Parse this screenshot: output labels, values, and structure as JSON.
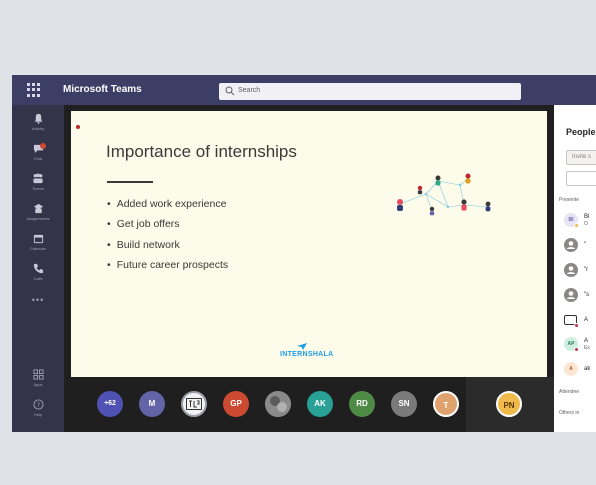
{
  "app": {
    "title": "Microsoft Teams",
    "search_placeholder": "Search"
  },
  "rail": {
    "items": [
      {
        "label": "Activity",
        "icon": "bell-icon"
      },
      {
        "label": "Chat",
        "icon": "chat-icon"
      },
      {
        "label": "Teams",
        "icon": "teams-icon"
      },
      {
        "label": "Assignments",
        "icon": "assignments-icon"
      },
      {
        "label": "Calendar",
        "icon": "calendar-icon"
      },
      {
        "label": "Calls",
        "icon": "phone-icon"
      },
      {
        "label": "Apps",
        "icon": "apps-icon"
      },
      {
        "label": "Help",
        "icon": "help-icon"
      }
    ],
    "more": "•••"
  },
  "slide": {
    "title": "Importance of internships",
    "bullets": [
      "Added work experience",
      "Get job offers",
      "Build network",
      "Future career prospects"
    ],
    "brand": "INTERNSHALA"
  },
  "participants": [
    {
      "initials": "+62",
      "color": "#4f52b2"
    },
    {
      "initials": "M",
      "color": "#6264a7"
    },
    {
      "initials": "",
      "color": "#f4f4f4"
    },
    {
      "initials": "GP",
      "color": "#cc4a31"
    },
    {
      "initials": "",
      "color": "#6d6d6d"
    },
    {
      "initials": "AK",
      "color": "#2aa197"
    },
    {
      "initials": "RD",
      "color": "#4e8b47"
    },
    {
      "initials": "SN",
      "color": "#7a7a7a"
    },
    {
      "initials": "T",
      "color": "#e0a26c"
    }
  ],
  "self": {
    "initials": "PN",
    "color": "#f0b94c"
  },
  "people_panel": {
    "title": "People",
    "invite_placeholder": "Invite s",
    "sections": {
      "presenters": "Presente",
      "attendees": "Attendee",
      "others": "Others in"
    },
    "rows": [
      {
        "initials": "BI",
        "name": "Bl",
        "subtitle": "O"
      },
      {
        "initials": "",
        "name": "\""
      },
      {
        "initials": "",
        "name": "\"r"
      },
      {
        "initials": "",
        "name": "\"s"
      },
      {
        "initials": "",
        "name": "A"
      },
      {
        "initials": "AP",
        "name": "A",
        "subtitle": "Ex"
      },
      {
        "initials": "A",
        "name": "ak"
      }
    ]
  }
}
